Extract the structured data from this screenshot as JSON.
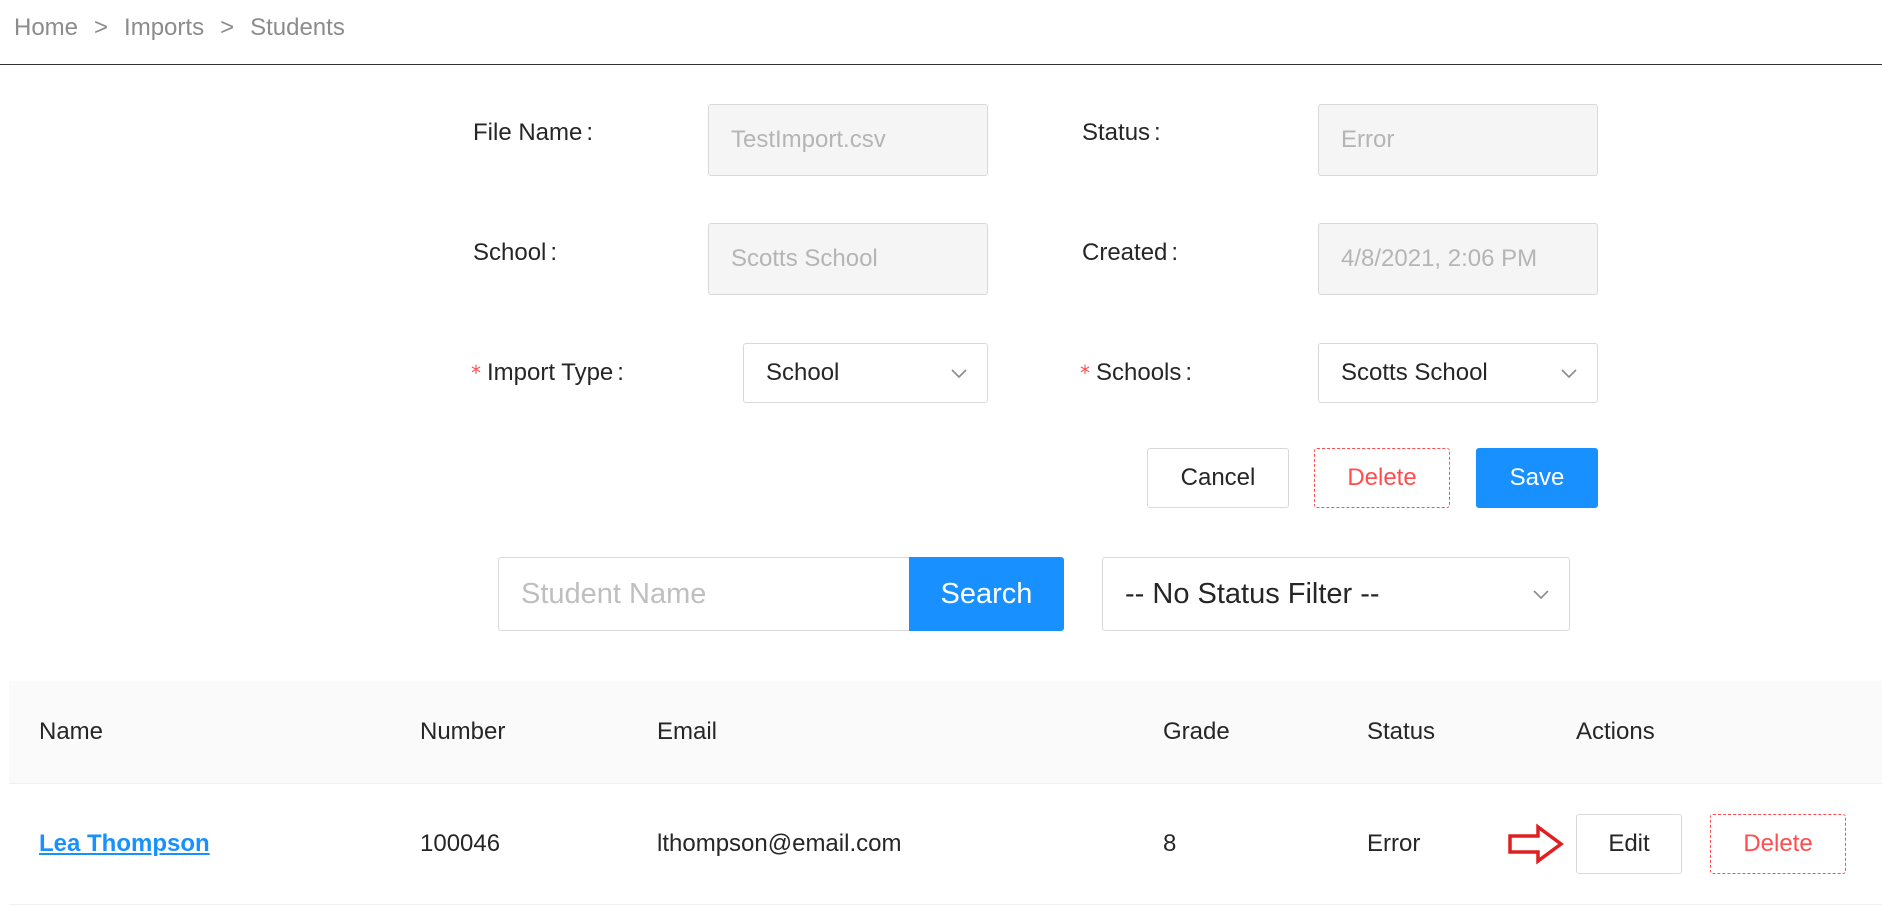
{
  "breadcrumb": [
    "Home",
    "Imports",
    "Students"
  ],
  "breadcrumb_separator": ">",
  "form": {
    "file_name": {
      "label": "File Name",
      "value": "TestImport.csv"
    },
    "status": {
      "label": "Status",
      "value": "Error"
    },
    "school": {
      "label": "School",
      "value": "Scotts School"
    },
    "created": {
      "label": "Created",
      "value": "4/8/2021, 2:06 PM"
    },
    "import_type": {
      "label": "Import Type",
      "value": "School",
      "required_mark": "*"
    },
    "schools": {
      "label": "Schools",
      "value": "Scotts School",
      "required_mark": "*"
    },
    "colon": ":"
  },
  "actions": {
    "cancel": "Cancel",
    "delete": "Delete",
    "save": "Save"
  },
  "search": {
    "placeholder": "Student Name",
    "button": "Search",
    "status_filter": "-- No Status Filter --"
  },
  "table": {
    "columns": [
      "Name",
      "Number",
      "Email",
      "Grade",
      "Status",
      "Actions"
    ],
    "rows": [
      {
        "name": "Lea Thompson",
        "number": "100046",
        "email": "lthompson@email.com",
        "grade": "8",
        "status": "Error",
        "edit": "Edit",
        "delete": "Delete"
      }
    ]
  },
  "colors": {
    "primary": "#1890ff",
    "danger": "#ff4d4f",
    "annotation": "#e02020"
  },
  "icons": {
    "chevron": "chevron-down-icon",
    "arrow": "arrow-right-icon"
  }
}
